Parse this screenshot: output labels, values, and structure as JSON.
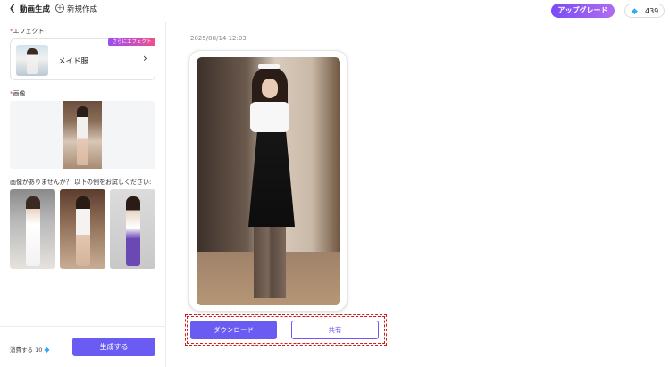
{
  "header": {
    "back_icon": "chevron-left-icon",
    "title": "動画生成",
    "new_icon": "plus-circle-icon",
    "new_label": "新規作成",
    "upgrade_label": "アップグレード",
    "gem_icon": "diamond-icon",
    "gem_count": "439"
  },
  "left_panel": {
    "effect_label": "エフェクト",
    "effect_badge": "さらにエフェクト",
    "effect_name": "メイド服",
    "effect_chevron_icon": "chevron-right-icon",
    "image_label": "画像",
    "samples_prompt": "画像がありませんか？ 以下の例をお試しください:",
    "consume_label": "消費する 10",
    "consume_icon": "diamond-icon",
    "generate_label": "生成する"
  },
  "result": {
    "timestamp": "2025/08/14 12:03",
    "download_label": "ダウンロード",
    "share_label": "共有"
  },
  "colors": {
    "accent": "#6a5bf2",
    "highlight_border": "#d11a1a",
    "required_star": "#e2454b"
  }
}
